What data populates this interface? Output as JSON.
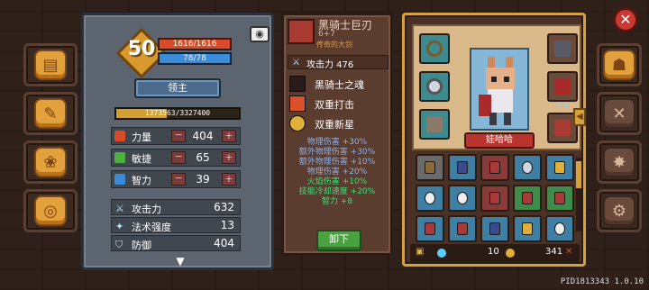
{
  "player": {
    "level": "50",
    "hp": "1616/1616",
    "mp": "78/78",
    "title": "领主",
    "exp_text": "1373563/3327400",
    "exp_fraction": 0.413
  },
  "attributes": [
    {
      "label": "力量",
      "value": "404",
      "minus": "−",
      "plus": "+",
      "color": "#d94a2a"
    },
    {
      "label": "敏捷",
      "value": "65",
      "minus": "−",
      "plus": "+",
      "color": "#4ab33f"
    },
    {
      "label": "智力",
      "value": "39",
      "minus": "−",
      "plus": "+",
      "color": "#3a8cd8"
    }
  ],
  "battle_stats": [
    {
      "label": "攻击力",
      "value": "632"
    },
    {
      "label": "法术强度",
      "value": "13"
    },
    {
      "label": "防御",
      "value": "404"
    }
  ],
  "weapon": {
    "name": "黑骑士巨刃",
    "plus": "6+7",
    "rarity": "传奇的大剑",
    "attack_label": "攻击力 476",
    "skills": [
      {
        "label": "黑骑士之魂",
        "color": "#2a1b1b"
      },
      {
        "label": "双重打击",
        "color": "#d9512a"
      },
      {
        "label": "双重新星",
        "color": "#e0b03a"
      }
    ],
    "bonuses": [
      {
        "text": "物理伤害 +30%",
        "color": "#8fb0e8"
      },
      {
        "text": "额外物理伤害 +30%",
        "color": "#8fb0e8"
      },
      {
        "text": "额外物理伤害 +10%",
        "color": "#8fb0e8"
      },
      {
        "text": "物理伤害 +20%",
        "color": "#8fb0e8"
      },
      {
        "text": "火焰伤害 +10%",
        "color": "#3fe07a"
      },
      {
        "text": "技能冷却速度 +20%",
        "color": "#3fe07a"
      },
      {
        "text": "智力 +8",
        "color": "#3fe07a"
      }
    ],
    "unequip_label": "卸下"
  },
  "character": {
    "name": "娃哈哈",
    "slot_badge": "+5"
  },
  "currency": {
    "gems": "10",
    "gold": "341"
  },
  "close_label": "✕",
  "pid": "PID1813343 1.0.10",
  "colors": {
    "accent_gold": "#d6a23d",
    "hp_red": "#d94a2a",
    "mp_blue": "#3a8cd8",
    "bonus_blue": "#8fb0e8",
    "bonus_green": "#3fe07a"
  }
}
